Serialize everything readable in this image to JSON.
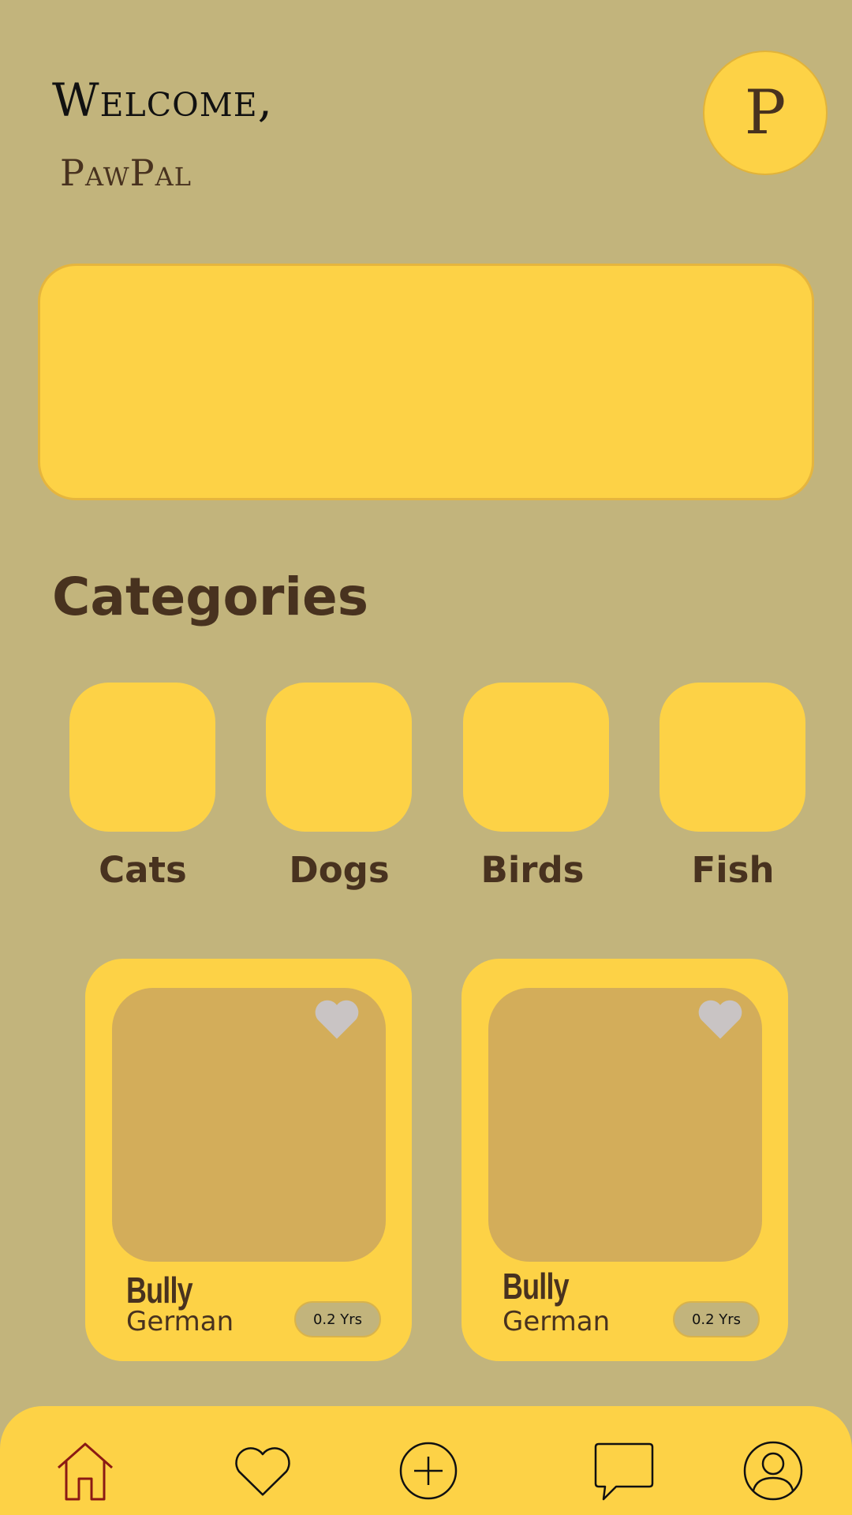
{
  "header": {
    "greeting": "Welcome,",
    "username": "PawPal",
    "avatar_initial": "P"
  },
  "categories": {
    "title": "Categories",
    "items": [
      {
        "label": "Cats"
      },
      {
        "label": "Dogs"
      },
      {
        "label": "Birds"
      },
      {
        "label": "Fish"
      }
    ]
  },
  "pets": [
    {
      "name": "Bully",
      "breed": "German",
      "age": "0.2 Yrs"
    },
    {
      "name": "Bully",
      "breed": "German",
      "age": "0.2 Yrs"
    }
  ],
  "nav": {
    "items": [
      {
        "icon": "home-icon"
      },
      {
        "icon": "heart-icon"
      },
      {
        "icon": "plus-circle-icon"
      },
      {
        "icon": "chat-icon"
      },
      {
        "icon": "user-icon"
      }
    ]
  },
  "colors": {
    "background": "#c2b47c",
    "accent": "#fdd246",
    "text": "#48321f",
    "photo_placeholder": "#d3ad5a"
  }
}
